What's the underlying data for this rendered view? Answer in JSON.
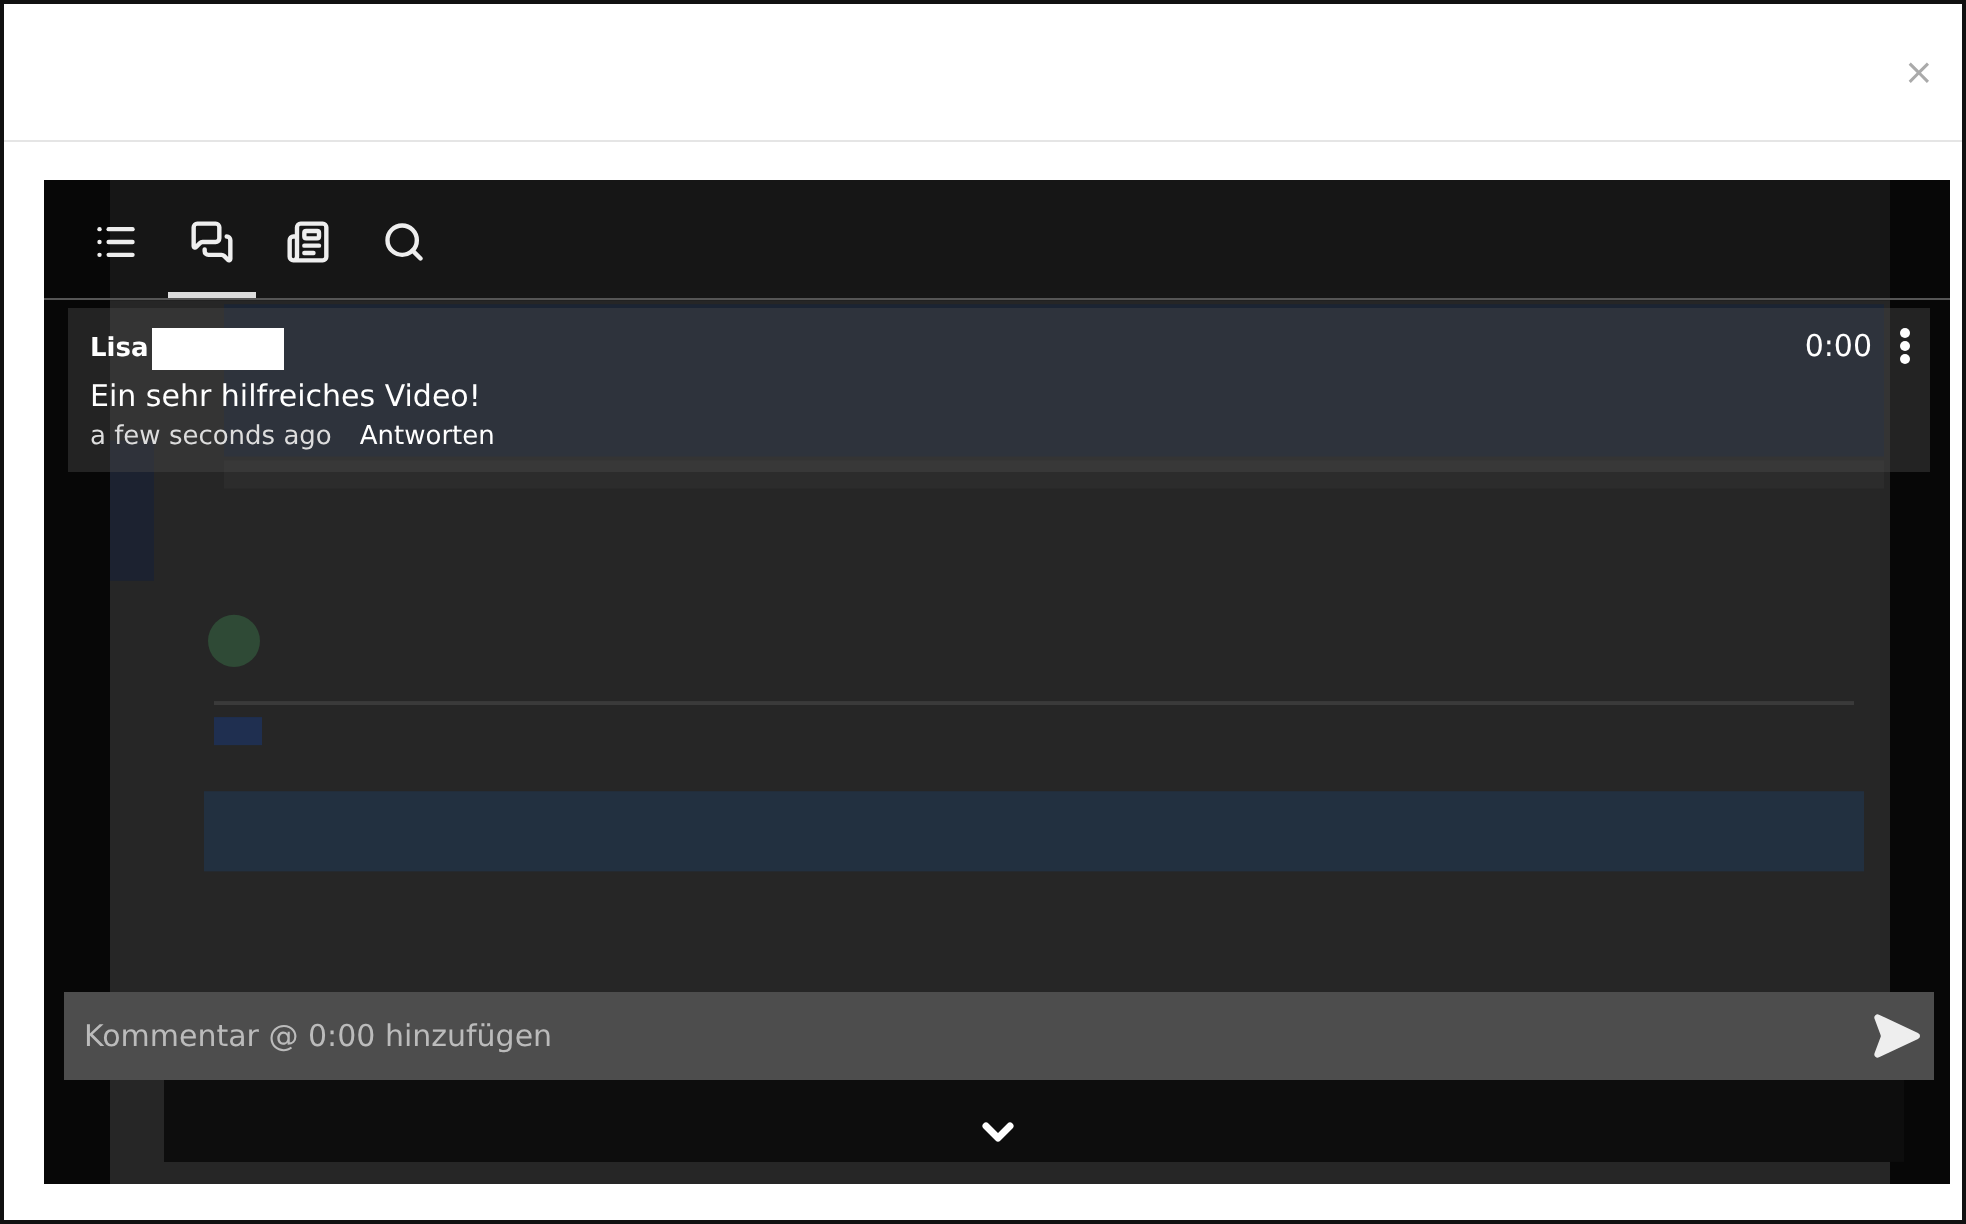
{
  "dialog": {
    "close": "×"
  },
  "tabs": [
    {
      "kind": "list",
      "selected": false
    },
    {
      "kind": "comments",
      "selected": true
    },
    {
      "kind": "notes",
      "selected": false
    },
    {
      "kind": "search",
      "selected": false
    }
  ],
  "comments": [
    {
      "author": "Lisa",
      "text": "Ein sehr hilfreiches Video!",
      "time": "a few seconds ago",
      "reply": "Antworten",
      "timestamp": "0:00"
    }
  ],
  "composer": {
    "placeholder": "Kommentar @ 0:00 hinzufügen"
  }
}
